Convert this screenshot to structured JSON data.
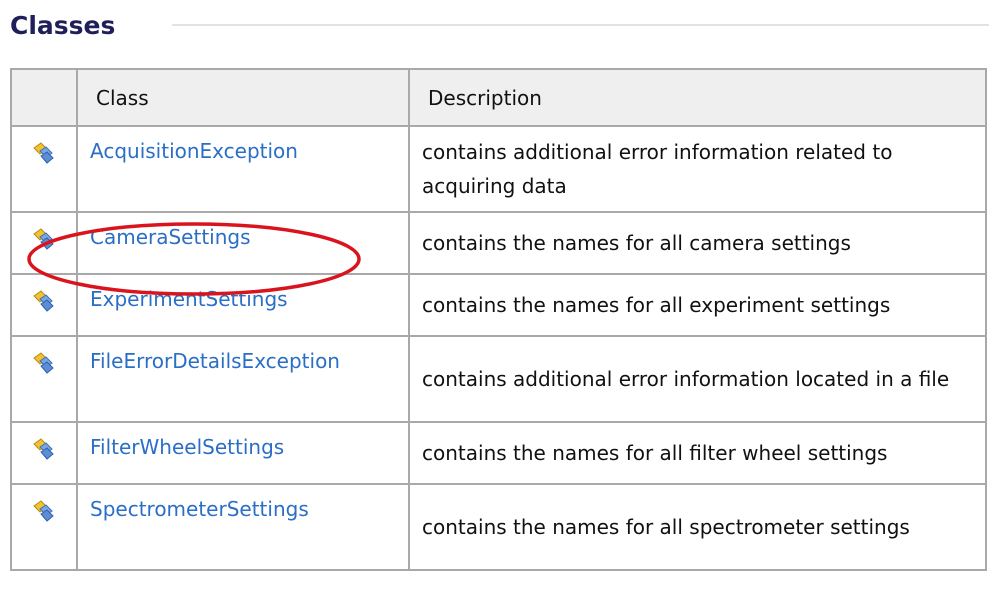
{
  "section": {
    "title": "Classes"
  },
  "table": {
    "headers": {
      "class": "Class",
      "description": "Description"
    },
    "rows": [
      {
        "name": "AcquisitionException",
        "description": "contains additional error information related to acquiring data"
      },
      {
        "name": "CameraSettings",
        "description": "contains the names for all camera settings"
      },
      {
        "name": "ExperimentSettings",
        "description": "contains the names for all experiment settings"
      },
      {
        "name": "FileErrorDetailsException",
        "description": "contains additional error information located in a file"
      },
      {
        "name": "FilterWheelSettings",
        "description": "contains the names for all filter wheel settings"
      },
      {
        "name": "SpectrometerSettings",
        "description": "contains the names for all spectrometer settings"
      }
    ]
  },
  "icons": {
    "row_icon": "public-class-icon",
    "annotation": "highlight-ellipse"
  },
  "colors": {
    "title": "#1f1f5a",
    "link": "#2a6ec6",
    "header_bg": "#efefef",
    "border": "#a9a9a9",
    "annotation": "#d9141c"
  }
}
